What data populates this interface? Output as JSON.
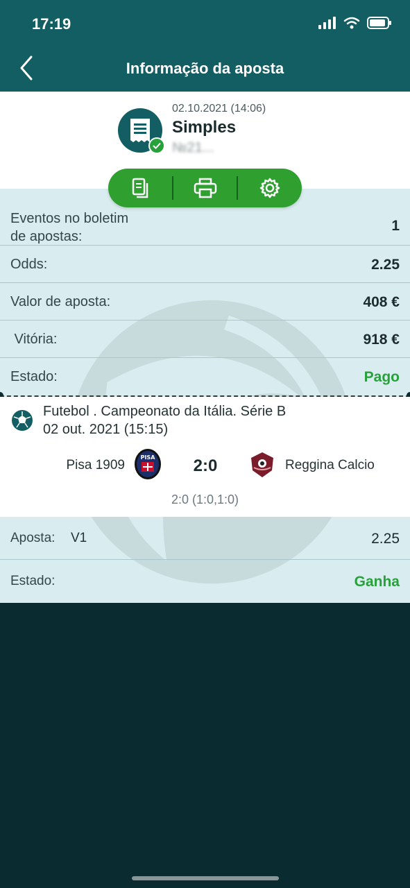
{
  "status_bar": {
    "time": "17:19"
  },
  "header": {
    "title": "Informação da aposta"
  },
  "ticket": {
    "date": "02.10.2021 (14:06)",
    "type": "Simples",
    "number": "№21..."
  },
  "details": [
    {
      "label": "Eventos no boletim\nde apostas:",
      "value": "1"
    },
    {
      "label": "Odds:",
      "value": "2.25"
    },
    {
      "label": "Valor de aposta:",
      "value": "408 €"
    },
    {
      "label": " Vitória:",
      "value": "918 €"
    },
    {
      "label": "Estado:",
      "value": "Pago"
    }
  ],
  "event": {
    "league": "Futebol . Campeonato da Itália. Série B",
    "date": "02 out. 2021 (15:15)",
    "home": "Pisa 1909",
    "away": "Reggina Calcio",
    "home_logo_text": "PISA",
    "score": "2:0",
    "score_detail": "2:0 (1:0,1:0)"
  },
  "bet": {
    "label": "Aposta:",
    "selection": "V1",
    "odds": "2.25",
    "state_label": "Estado:",
    "state_value": "Ganha"
  },
  "colors": {
    "header": "#125e63",
    "accent_green": "#27a13a",
    "details_bg": "#d9ecef"
  },
  "icons": [
    "back-icon",
    "receipt-icon",
    "check-icon",
    "copy-icon",
    "print-icon",
    "gear-icon",
    "football-icon"
  ]
}
